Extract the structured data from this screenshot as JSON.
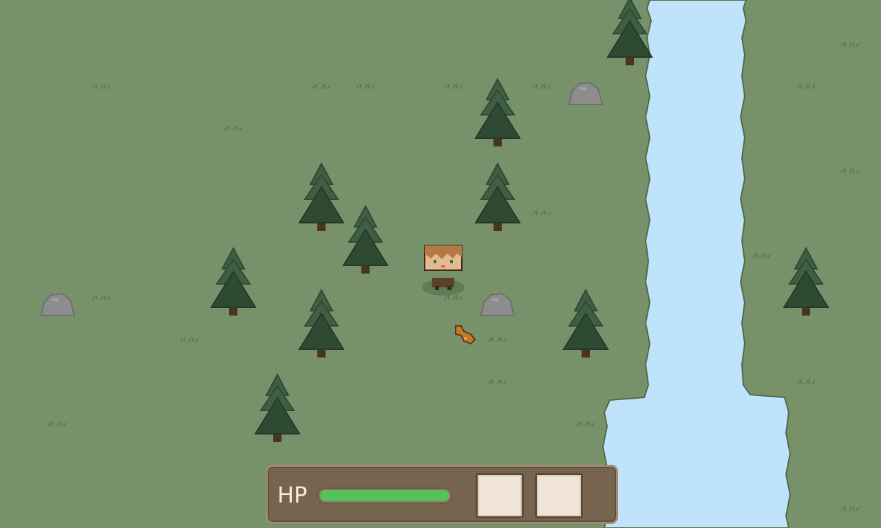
{
  "hud": {
    "hp_label": "HP",
    "hp_fraction": 1.0,
    "inventory_slots": [
      "",
      ""
    ]
  },
  "colors": {
    "grass": "#77926a",
    "grass_tuft": "#5e7a55",
    "water": "#bfe3fa",
    "shore_outline": "#4f6a48",
    "tree_dark": "#2f4a33",
    "tree_light": "#3f5e42",
    "tree_trunk": "#4a3322",
    "rock": "#8d8d8d",
    "hud_panel": "#76644f",
    "hp_fill": "#56c15a",
    "slot_fill": "#efe4d5"
  },
  "world": {
    "icons": [
      "pine-tree-icon",
      "rock-icon",
      "grass-tuft-icon",
      "player-character",
      "item-pickup-icon",
      "river"
    ]
  }
}
